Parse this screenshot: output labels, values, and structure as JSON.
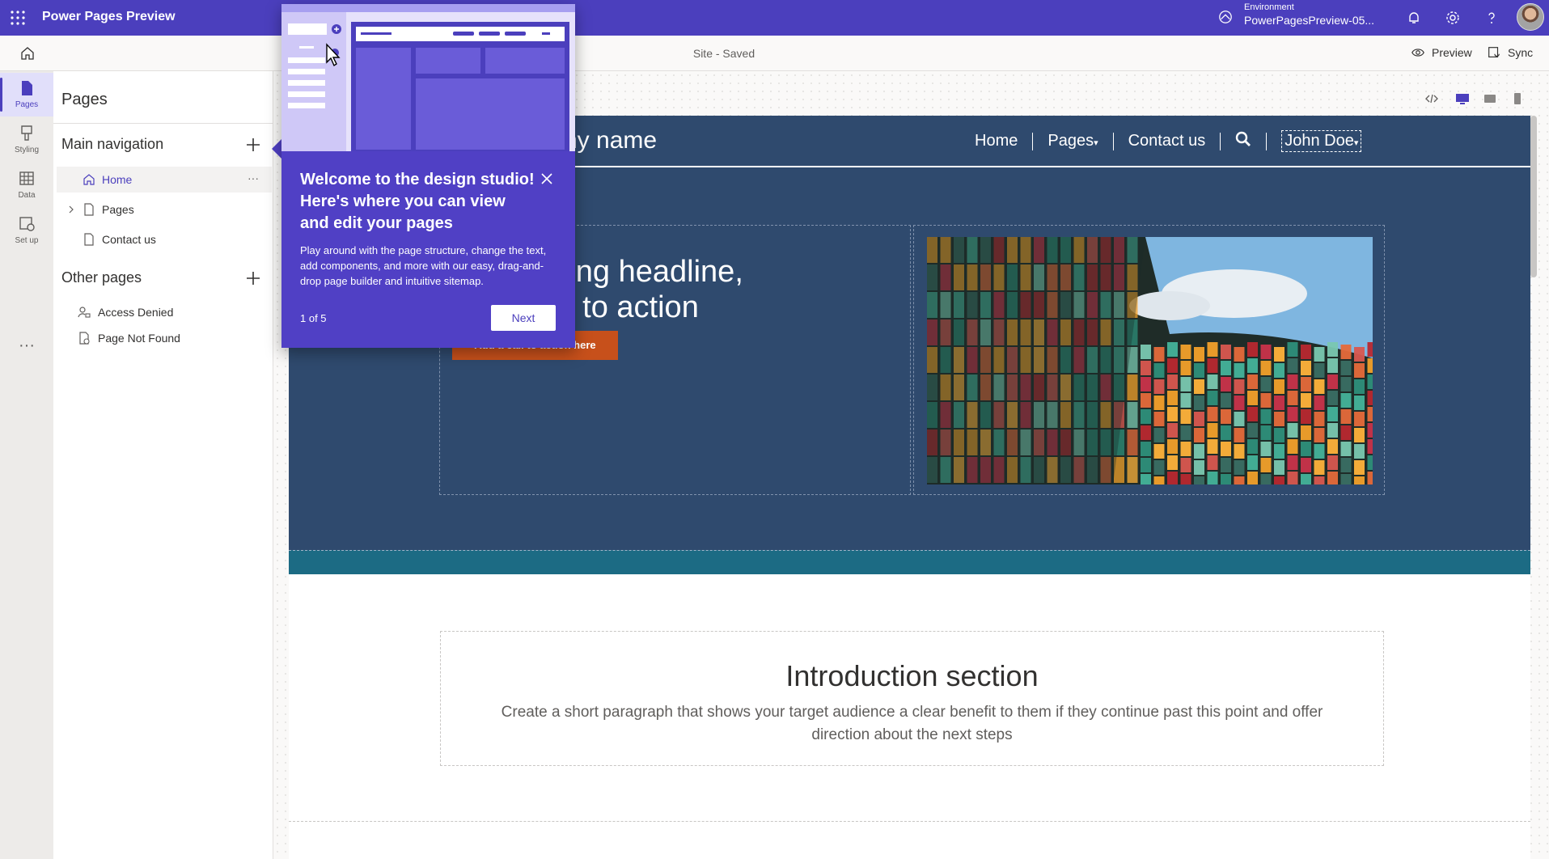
{
  "topbar": {
    "waffle_icon": "waffle-icon",
    "app_title": "Power Pages Preview",
    "environment_label": "Environment",
    "environment_name": "PowerPagesPreview-05...",
    "accent": "#4b3fbd"
  },
  "cmdbar": {
    "site_status": "Site - Saved",
    "preview_label": "Preview",
    "sync_label": "Sync"
  },
  "rail": {
    "items": [
      {
        "label": "Pages",
        "icon": "page-icon",
        "active": true
      },
      {
        "label": "Styling",
        "icon": "brush-icon",
        "active": false
      },
      {
        "label": "Data",
        "icon": "table-icon",
        "active": false
      },
      {
        "label": "Set up",
        "icon": "setup-icon",
        "active": false
      }
    ],
    "more": "···"
  },
  "pages_panel": {
    "title": "Pages",
    "main_nav_title": "Main navigation",
    "main_nav_items": [
      {
        "label": "Home",
        "icon": "home-icon",
        "selected": true
      },
      {
        "label": "Pages",
        "icon": "document-icon",
        "selected": false
      },
      {
        "label": "Contact us",
        "icon": "document-icon",
        "selected": false
      }
    ],
    "more_dots": "···",
    "other_pages_title": "Other pages",
    "other_pages_items": [
      {
        "label": "Access Denied",
        "icon": "person-lock-icon"
      },
      {
        "label": "Page Not Found",
        "icon": "document-error-icon"
      }
    ]
  },
  "site_preview": {
    "site_name": "ny name",
    "nav": [
      "Home",
      "Pages",
      "Contact us"
    ],
    "pages_caret": "▾",
    "user": "John Doe",
    "user_caret": "▾",
    "hero_headline_line1": "n engaging headline,",
    "hero_headline_line2": "e, or call to action",
    "cta_label": "Add a call to action here",
    "intro_title": "Introduction section",
    "intro_text": "Create a short paragraph that shows your target audience a clear benefit to them if they continue past this point and offer direction about the next steps",
    "header_color": "#2f4a6e",
    "cta_color": "#c7501b",
    "teal_color": "#1c6b84"
  },
  "coachmark": {
    "title": "Welcome to the design studio! Here's where you can view and edit your pages",
    "body": "Play around with the page structure, change the text, add components, and more with our easy, drag-and-drop page builder and intuitive sitemap.",
    "step": "1 of 5",
    "next_label": "Next",
    "bg_color": "#5040c5"
  }
}
